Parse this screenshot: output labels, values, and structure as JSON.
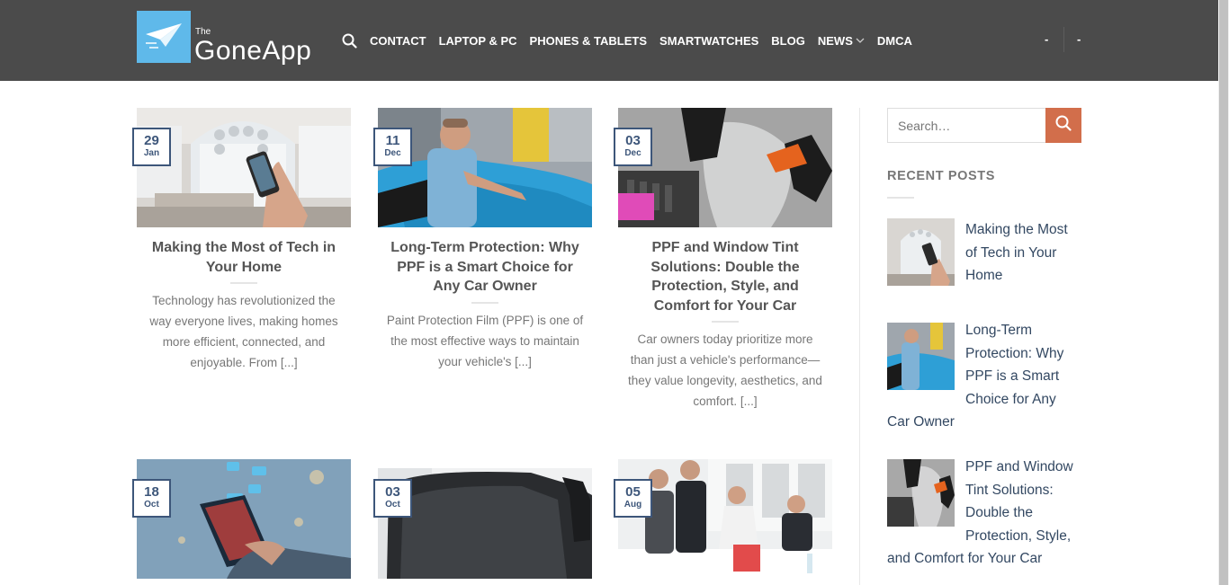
{
  "site": {
    "logo_small": "The",
    "logo_name": "GoneApp"
  },
  "nav": {
    "search_icon": "search-icon",
    "items": [
      "CONTACT",
      "LAPTOP & PC",
      "PHONES & TABLETS",
      "SMARTWATCHES",
      "BLOG",
      "NEWS",
      "DMCA"
    ],
    "news_dropdown_icon": "chevron-down-icon",
    "right_items": [
      "-",
      "-"
    ]
  },
  "posts": [
    {
      "day": "29",
      "month": "Jan",
      "title": "Making the Most of Tech in Your Home",
      "excerpt": "Technology has revolutionized the way everyone lives, making homes more efficient, connected, and enjoyable. From [...]"
    },
    {
      "day": "11",
      "month": "Dec",
      "title": "Long-Term Protection: Why PPF is a Smart Choice for Any Car Owner",
      "excerpt": "Paint Protection Film (PPF) is one of the most effective ways to maintain your vehicle's [...]"
    },
    {
      "day": "03",
      "month": "Dec",
      "title": "PPF and Window Tint Solutions: Double the Protection, Style, and Comfort for Your Car",
      "excerpt": "Car owners today prioritize more than just a vehicle's performance—they value longevity, aesthetics, and comfort. [...]"
    },
    {
      "day": "18",
      "month": "Oct",
      "title": "",
      "excerpt": ""
    },
    {
      "day": "03",
      "month": "Oct",
      "title": "",
      "excerpt": ""
    },
    {
      "day": "05",
      "month": "Aug",
      "title": "",
      "excerpt": ""
    }
  ],
  "sidebar": {
    "search_placeholder": "Search…",
    "search_button_icon": "search-icon",
    "recent_title": "RECENT POSTS",
    "recent": [
      "Making the Most of Tech in Your Home",
      "Long-Term Protection: Why PPF is a Smart Choice for Any Car Owner",
      "PPF and Window Tint Solutions: Double the Protection, Style, and Comfort for Your Car"
    ]
  },
  "colors": {
    "header_bg": "#4b4b4b",
    "logo_bg": "#5fb9ea",
    "badge_border": "#3d567a",
    "search_button": "#d26e4b",
    "link": "#334862"
  }
}
